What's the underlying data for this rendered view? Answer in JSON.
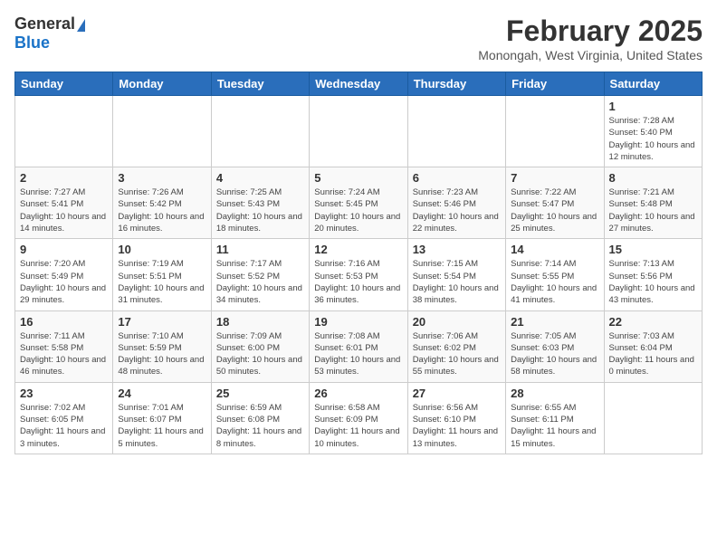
{
  "header": {
    "logo_general": "General",
    "logo_blue": "Blue",
    "month_year": "February 2025",
    "location": "Monongah, West Virginia, United States"
  },
  "days_of_week": [
    "Sunday",
    "Monday",
    "Tuesday",
    "Wednesday",
    "Thursday",
    "Friday",
    "Saturday"
  ],
  "weeks": [
    [
      {
        "day": "",
        "info": ""
      },
      {
        "day": "",
        "info": ""
      },
      {
        "day": "",
        "info": ""
      },
      {
        "day": "",
        "info": ""
      },
      {
        "day": "",
        "info": ""
      },
      {
        "day": "",
        "info": ""
      },
      {
        "day": "1",
        "info": "Sunrise: 7:28 AM\nSunset: 5:40 PM\nDaylight: 10 hours and 12 minutes."
      }
    ],
    [
      {
        "day": "2",
        "info": "Sunrise: 7:27 AM\nSunset: 5:41 PM\nDaylight: 10 hours and 14 minutes."
      },
      {
        "day": "3",
        "info": "Sunrise: 7:26 AM\nSunset: 5:42 PM\nDaylight: 10 hours and 16 minutes."
      },
      {
        "day": "4",
        "info": "Sunrise: 7:25 AM\nSunset: 5:43 PM\nDaylight: 10 hours and 18 minutes."
      },
      {
        "day": "5",
        "info": "Sunrise: 7:24 AM\nSunset: 5:45 PM\nDaylight: 10 hours and 20 minutes."
      },
      {
        "day": "6",
        "info": "Sunrise: 7:23 AM\nSunset: 5:46 PM\nDaylight: 10 hours and 22 minutes."
      },
      {
        "day": "7",
        "info": "Sunrise: 7:22 AM\nSunset: 5:47 PM\nDaylight: 10 hours and 25 minutes."
      },
      {
        "day": "8",
        "info": "Sunrise: 7:21 AM\nSunset: 5:48 PM\nDaylight: 10 hours and 27 minutes."
      }
    ],
    [
      {
        "day": "9",
        "info": "Sunrise: 7:20 AM\nSunset: 5:49 PM\nDaylight: 10 hours and 29 minutes."
      },
      {
        "day": "10",
        "info": "Sunrise: 7:19 AM\nSunset: 5:51 PM\nDaylight: 10 hours and 31 minutes."
      },
      {
        "day": "11",
        "info": "Sunrise: 7:17 AM\nSunset: 5:52 PM\nDaylight: 10 hours and 34 minutes."
      },
      {
        "day": "12",
        "info": "Sunrise: 7:16 AM\nSunset: 5:53 PM\nDaylight: 10 hours and 36 minutes."
      },
      {
        "day": "13",
        "info": "Sunrise: 7:15 AM\nSunset: 5:54 PM\nDaylight: 10 hours and 38 minutes."
      },
      {
        "day": "14",
        "info": "Sunrise: 7:14 AM\nSunset: 5:55 PM\nDaylight: 10 hours and 41 minutes."
      },
      {
        "day": "15",
        "info": "Sunrise: 7:13 AM\nSunset: 5:56 PM\nDaylight: 10 hours and 43 minutes."
      }
    ],
    [
      {
        "day": "16",
        "info": "Sunrise: 7:11 AM\nSunset: 5:58 PM\nDaylight: 10 hours and 46 minutes."
      },
      {
        "day": "17",
        "info": "Sunrise: 7:10 AM\nSunset: 5:59 PM\nDaylight: 10 hours and 48 minutes."
      },
      {
        "day": "18",
        "info": "Sunrise: 7:09 AM\nSunset: 6:00 PM\nDaylight: 10 hours and 50 minutes."
      },
      {
        "day": "19",
        "info": "Sunrise: 7:08 AM\nSunset: 6:01 PM\nDaylight: 10 hours and 53 minutes."
      },
      {
        "day": "20",
        "info": "Sunrise: 7:06 AM\nSunset: 6:02 PM\nDaylight: 10 hours and 55 minutes."
      },
      {
        "day": "21",
        "info": "Sunrise: 7:05 AM\nSunset: 6:03 PM\nDaylight: 10 hours and 58 minutes."
      },
      {
        "day": "22",
        "info": "Sunrise: 7:03 AM\nSunset: 6:04 PM\nDaylight: 11 hours and 0 minutes."
      }
    ],
    [
      {
        "day": "23",
        "info": "Sunrise: 7:02 AM\nSunset: 6:05 PM\nDaylight: 11 hours and 3 minutes."
      },
      {
        "day": "24",
        "info": "Sunrise: 7:01 AM\nSunset: 6:07 PM\nDaylight: 11 hours and 5 minutes."
      },
      {
        "day": "25",
        "info": "Sunrise: 6:59 AM\nSunset: 6:08 PM\nDaylight: 11 hours and 8 minutes."
      },
      {
        "day": "26",
        "info": "Sunrise: 6:58 AM\nSunset: 6:09 PM\nDaylight: 11 hours and 10 minutes."
      },
      {
        "day": "27",
        "info": "Sunrise: 6:56 AM\nSunset: 6:10 PM\nDaylight: 11 hours and 13 minutes."
      },
      {
        "day": "28",
        "info": "Sunrise: 6:55 AM\nSunset: 6:11 PM\nDaylight: 11 hours and 15 minutes."
      },
      {
        "day": "",
        "info": ""
      }
    ]
  ]
}
